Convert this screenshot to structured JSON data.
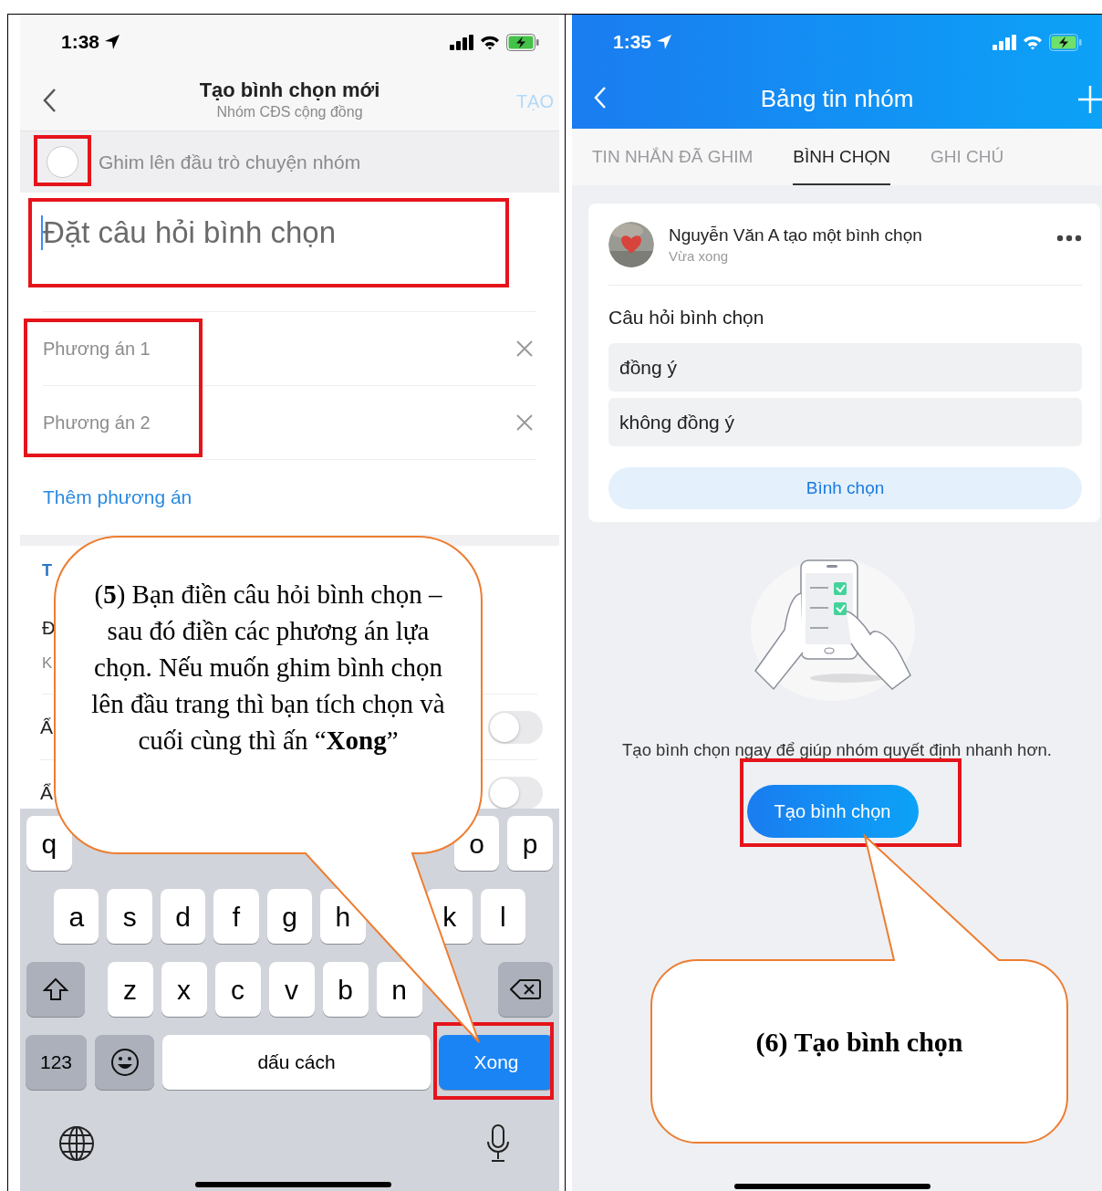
{
  "left_screen": {
    "status_bar": {
      "time": "1:38"
    },
    "nav": {
      "title": "Tạo bình chọn mới",
      "subtitle": "Nhóm CĐS cộng đồng",
      "action": "TẠO"
    },
    "pin_option": {
      "label": "Ghim lên đầu trò chuyện nhóm",
      "checked": false
    },
    "question_field": {
      "placeholder": "Đặt câu hỏi bình chọn"
    },
    "options": [
      {
        "placeholder": "Phương án 1"
      },
      {
        "placeholder": "Phương án 2"
      }
    ],
    "add_option": "Thêm phương án",
    "settings_rows": [
      {
        "kind": "heading",
        "label": "T"
      },
      {
        "kind": "detail",
        "label": "Đ",
        "hint": "K"
      },
      {
        "kind": "toggle",
        "label": "Ẩ",
        "on": false
      },
      {
        "kind": "toggle",
        "label": "Ẩ",
        "on": false
      }
    ],
    "keyboard": {
      "rows": [
        {
          "keys": [
            {
              "kind": "letter",
              "label": "q"
            },
            {
              "kind": "covered"
            },
            {
              "kind": "covered"
            },
            {
              "kind": "covered"
            },
            {
              "kind": "covered"
            },
            {
              "kind": "covered"
            },
            {
              "kind": "covered"
            },
            {
              "kind": "covered"
            },
            {
              "kind": "letter",
              "label": "o"
            },
            {
              "kind": "letter",
              "label": "p"
            }
          ]
        },
        {
          "keys": [
            {
              "kind": "letter",
              "label": "a"
            },
            {
              "kind": "letter",
              "label": "s"
            },
            {
              "kind": "letter",
              "label": "d"
            },
            {
              "kind": "letter",
              "label": "f"
            },
            {
              "kind": "letter",
              "label": "g"
            },
            {
              "kind": "letter",
              "label": "h"
            },
            {
              "kind": "covered"
            },
            {
              "kind": "letter",
              "label": "k"
            },
            {
              "kind": "letter",
              "label": "l"
            }
          ]
        },
        {
          "keys": [
            {
              "kind": "shift"
            },
            {
              "kind": "letter",
              "label": "z"
            },
            {
              "kind": "letter",
              "label": "x"
            },
            {
              "kind": "letter",
              "label": "c"
            },
            {
              "kind": "letter",
              "label": "v"
            },
            {
              "kind": "letter",
              "label": "b"
            },
            {
              "kind": "letter",
              "label": "n"
            },
            {
              "kind": "covered"
            },
            {
              "kind": "backspace"
            }
          ]
        }
      ],
      "bottom_row": [
        {
          "kind": "numbers",
          "label": "123"
        },
        {
          "kind": "emoji"
        },
        {
          "kind": "space",
          "label": "dấu cách"
        },
        {
          "kind": "done",
          "label": "Xong"
        }
      ]
    }
  },
  "right_screen": {
    "status_bar": {
      "time": "1:35"
    },
    "nav": {
      "title": "Bảng tin nhóm"
    },
    "tabs": [
      {
        "label": "TIN NHẮN ĐÃ GHIM",
        "selected": false
      },
      {
        "label": "BÌNH CHỌN",
        "selected": true
      },
      {
        "label": "GHI CHÚ",
        "selected": false
      }
    ],
    "poll_card": {
      "author_line": "Nguyễn Văn A tạo một bình chọn",
      "time": "Vừa xong",
      "question": "Câu hỏi bình chọn",
      "options": [
        "đồng ý",
        "không đồng ý"
      ],
      "vote_button": "Bình chọn"
    },
    "empty_state": {
      "message": "Tạo bình chọn ngay để giúp nhóm quyết định nhanh hơn.",
      "button": "Tạo bình chọn"
    }
  },
  "callouts": [
    {
      "text": "(**5**) Bạn điền câu hỏi bình chọn – sau đó điền các phương án lựa chọn. Nếu muốn ghim bình chọn lên đầu trang thì bạn tích chọn và cuối cùng thì ấn “**Xong**”",
      "bold": false
    },
    {
      "text": "(6) Tạo bình chọn",
      "bold": true
    }
  ]
}
